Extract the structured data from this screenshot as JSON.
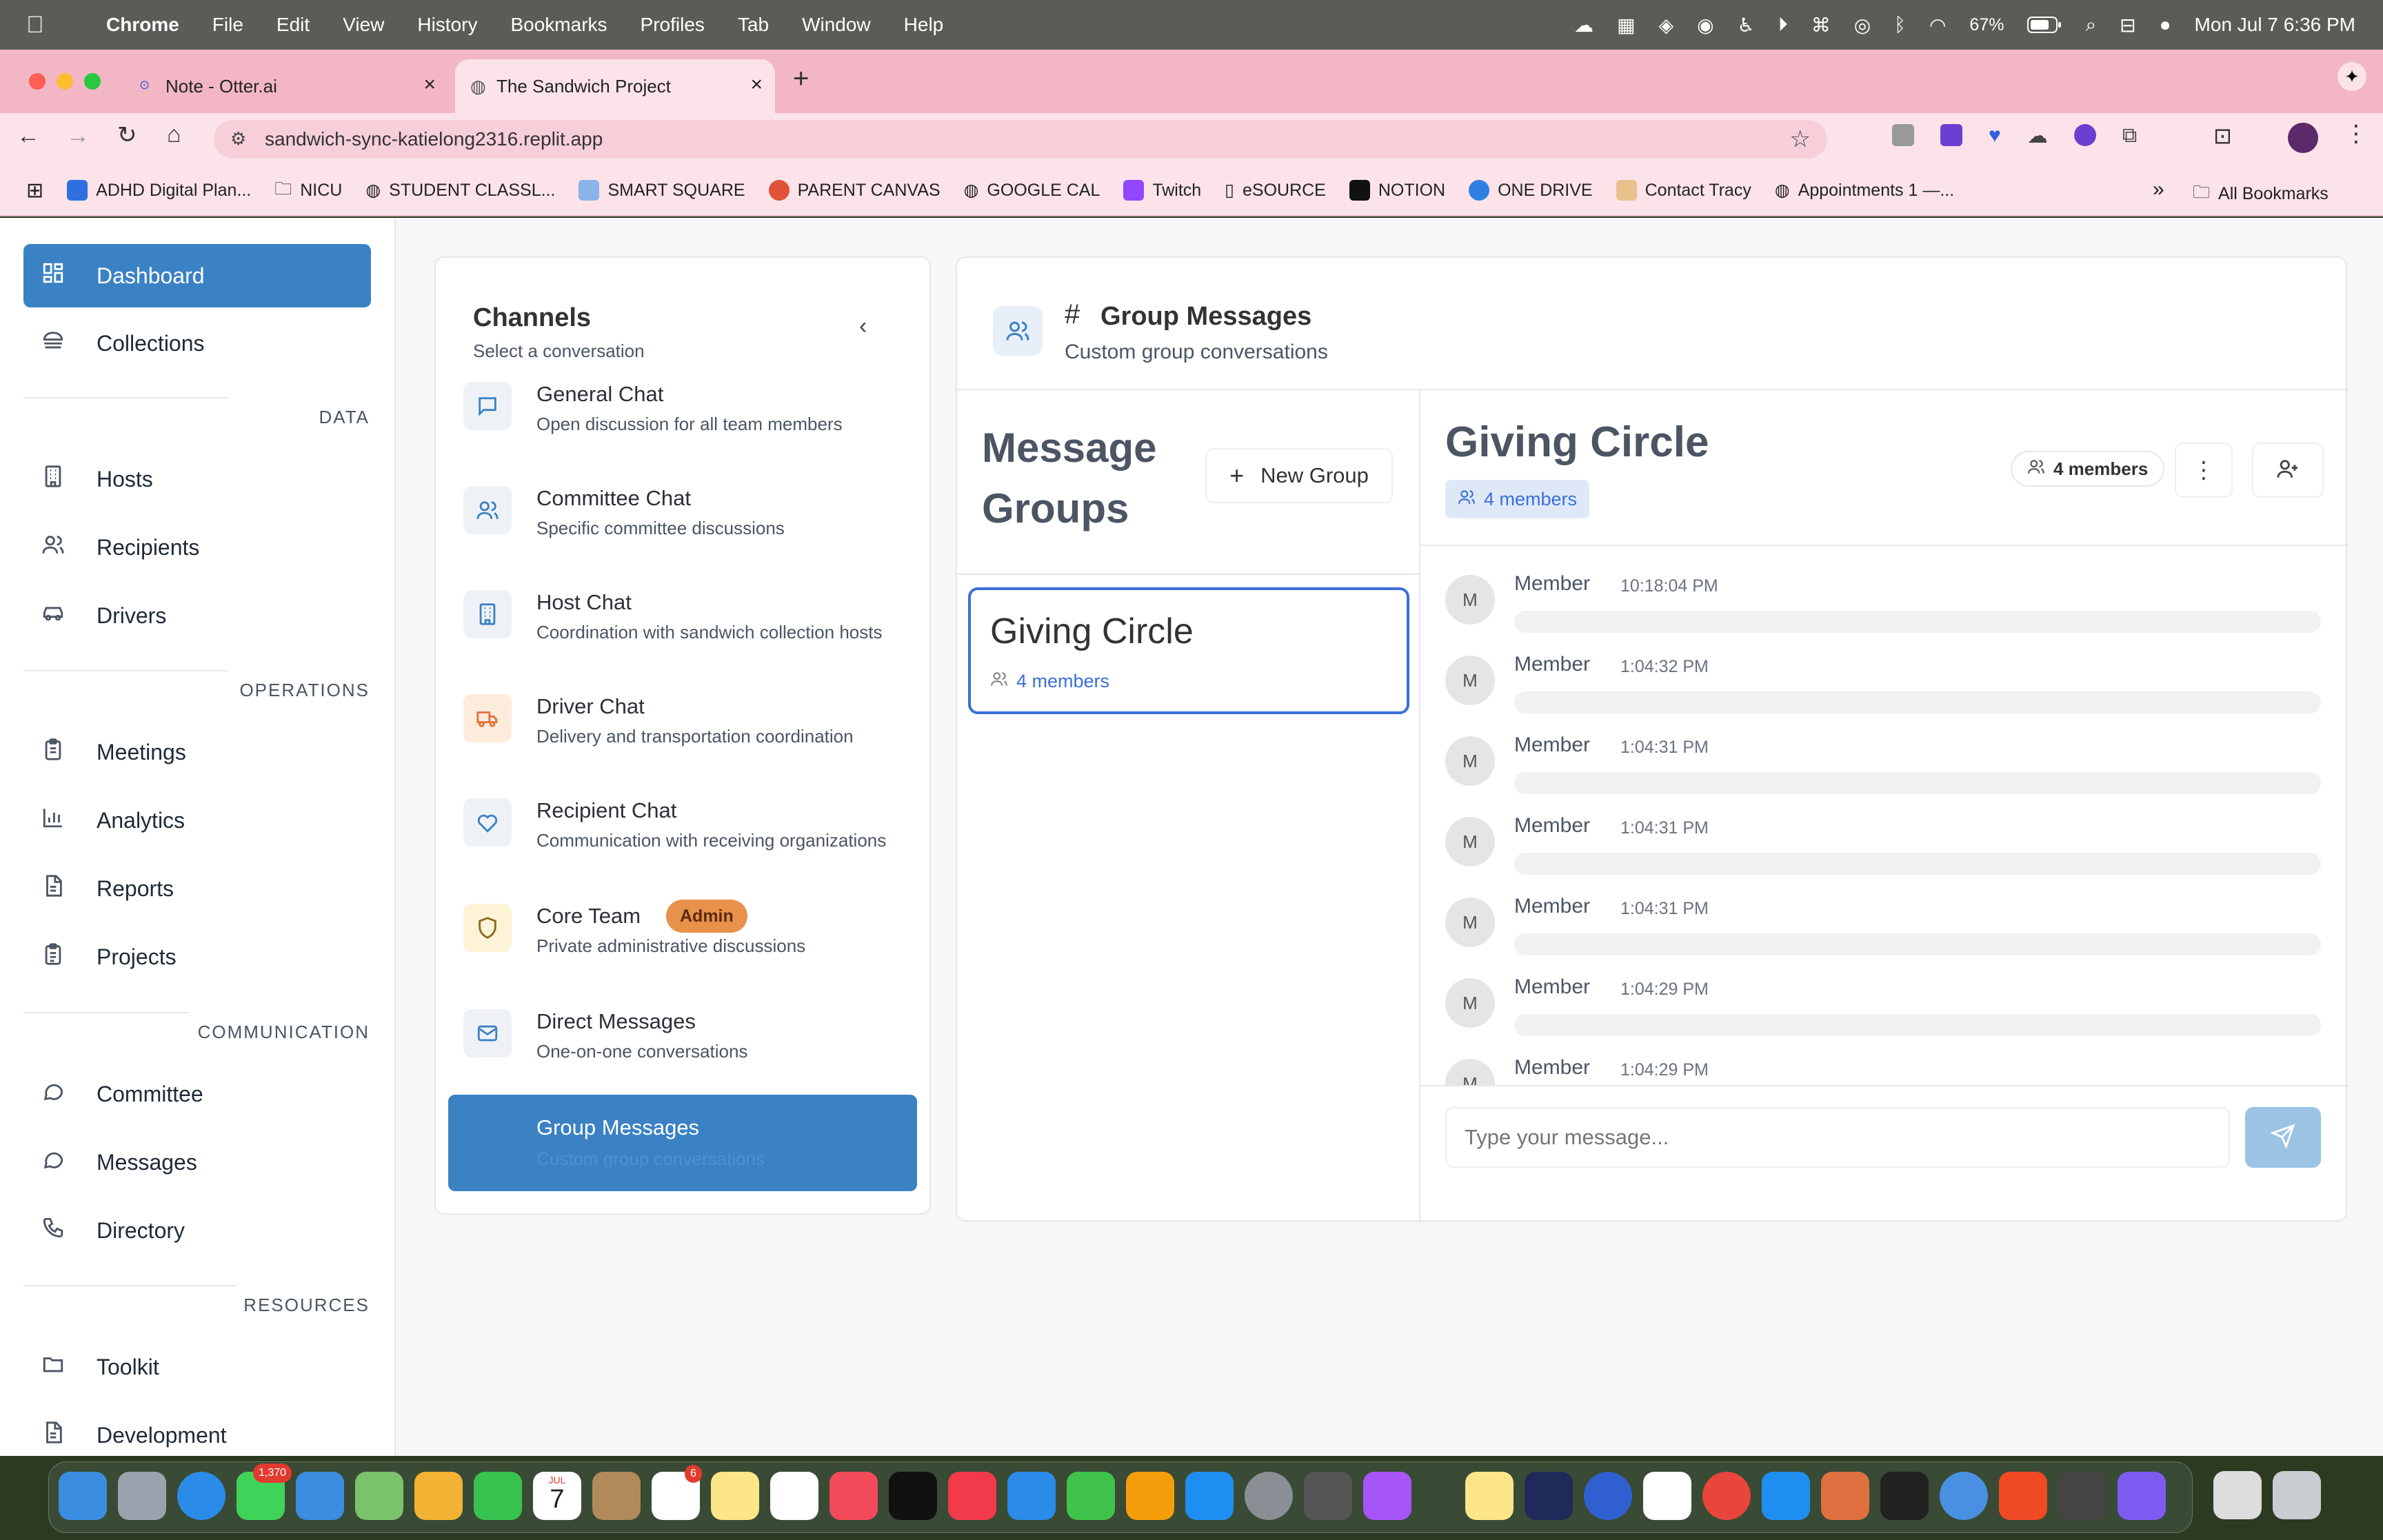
{
  "menubar": {
    "app": "Chrome",
    "items": [
      "File",
      "Edit",
      "View",
      "History",
      "Bookmarks",
      "Profiles",
      "Tab",
      "Window",
      "Help"
    ],
    "battery": "67%",
    "datetime": "Mon Jul 7  6:36 PM"
  },
  "browser": {
    "tabs": [
      {
        "title": "Note - Otter.ai"
      },
      {
        "title": "The Sandwich Project"
      }
    ],
    "url": "sandwich-sync-katielong2316.replit.app",
    "bookmarks": [
      "ADHD Digital Plan...",
      "NICU",
      "STUDENT CLASSL...",
      "SMART SQUARE",
      "PARENT CANVAS",
      "GOOGLE CAL",
      "Twitch",
      "eSOURCE",
      "NOTION",
      "ONE DRIVE",
      "Contact Tracy",
      "Appointments 1 —..."
    ],
    "all_bookmarks": "All Bookmarks"
  },
  "sidebar": {
    "top": [
      {
        "label": "Dashboard",
        "icon": "grid-icon"
      },
      {
        "label": "Collections",
        "icon": "sandwich-icon"
      }
    ],
    "sections": [
      {
        "title": "DATA",
        "items": [
          {
            "label": "Hosts",
            "icon": "building-icon"
          },
          {
            "label": "Recipients",
            "icon": "users-icon"
          },
          {
            "label": "Drivers",
            "icon": "car-icon"
          }
        ]
      },
      {
        "title": "OPERATIONS",
        "items": [
          {
            "label": "Meetings",
            "icon": "clipboard-icon"
          },
          {
            "label": "Analytics",
            "icon": "bar-chart-icon"
          },
          {
            "label": "Reports",
            "icon": "file-icon"
          },
          {
            "label": "Projects",
            "icon": "clipboard-list-icon"
          }
        ]
      },
      {
        "title": "COMMUNICATION",
        "items": [
          {
            "label": "Committee",
            "icon": "chat-bubble-icon"
          },
          {
            "label": "Messages",
            "icon": "chat-bubble-icon"
          },
          {
            "label": "Directory",
            "icon": "phone-icon"
          }
        ]
      },
      {
        "title": "RESOURCES",
        "items": [
          {
            "label": "Toolkit",
            "icon": "folder-icon"
          },
          {
            "label": "Development",
            "icon": "file-icon"
          }
        ]
      }
    ]
  },
  "channels": {
    "title": "Channels",
    "subtitle": "Select a conversation",
    "items": [
      {
        "title": "General Chat",
        "desc": "Open discussion for all team members",
        "icon": "message-square-icon"
      },
      {
        "title": "Committee Chat",
        "desc": "Specific committee discussions",
        "icon": "users-icon"
      },
      {
        "title": "Host Chat",
        "desc": "Coordination with sandwich collection hosts",
        "icon": "building-icon"
      },
      {
        "title": "Driver Chat",
        "desc": "Delivery and transportation coordination",
        "icon": "truck-icon"
      },
      {
        "title": "Recipient Chat",
        "desc": "Communication with receiving organizations",
        "icon": "heart-icon"
      },
      {
        "title": "Core Team",
        "desc": "Private administrative discussions",
        "icon": "shield-icon",
        "badge": "Admin"
      },
      {
        "title": "Direct Messages",
        "desc": "One-on-one conversations",
        "icon": "mail-icon"
      },
      {
        "title": "Group Messages",
        "desc": "Custom group conversations",
        "icon": "users-icon"
      }
    ]
  },
  "main": {
    "header": {
      "hash": "#",
      "title": "Group Messages",
      "subtitle": "Custom group conversations"
    },
    "groups": {
      "title_line1": "Message",
      "title_line2": "Groups",
      "new_group": "New Group",
      "cards": [
        {
          "name": "Giving Circle",
          "members": "4 members"
        }
      ]
    },
    "chat": {
      "title": "Giving Circle",
      "members_badge": "4 members",
      "members_button": "4 members",
      "messages": [
        {
          "avatar": "M",
          "name": "Member",
          "time": "10:18:04 PM"
        },
        {
          "avatar": "M",
          "name": "Member",
          "time": "1:04:32 PM"
        },
        {
          "avatar": "M",
          "name": "Member",
          "time": "1:04:31 PM"
        },
        {
          "avatar": "M",
          "name": "Member",
          "time": "1:04:31 PM"
        },
        {
          "avatar": "M",
          "name": "Member",
          "time": "1:04:31 PM"
        },
        {
          "avatar": "M",
          "name": "Member",
          "time": "1:04:29 PM"
        },
        {
          "avatar": "M",
          "name": "Member",
          "time": "1:04:29 PM"
        }
      ],
      "input_placeholder": "Type your message..."
    }
  },
  "dock": {
    "badges": {
      "messages": "1,370",
      "reminders": "6",
      "calendar_month": "JUL",
      "calendar_day": "7"
    }
  }
}
